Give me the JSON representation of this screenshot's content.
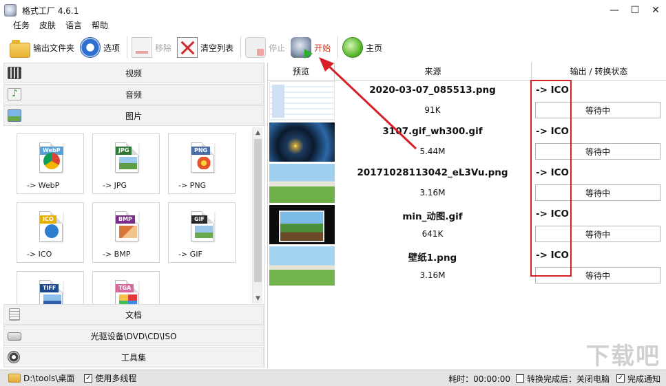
{
  "window": {
    "title": "格式工厂 4.6.1",
    "controls": [
      "—",
      "☐",
      "✕"
    ]
  },
  "menu": [
    "任务",
    "皮肤",
    "语言",
    "帮助"
  ],
  "toolbar": {
    "output_folder": "输出文件夹",
    "options": "选项",
    "remove": "移除",
    "clear_list": "清空列表",
    "stop": "停止",
    "start": "开始",
    "home": "主页"
  },
  "categories": {
    "video": "视频",
    "audio": "音频",
    "image": "图片",
    "document": "文档",
    "disc": "光驱设备\\DVD\\CD\\ISO",
    "tools": "工具集"
  },
  "formats": [
    {
      "tag": "WebP",
      "label": "-> WebP",
      "color": "#5aa0d8"
    },
    {
      "tag": "JPG",
      "label": "-> JPG",
      "color": "#2e7a36"
    },
    {
      "tag": "PNG",
      "label": "-> PNG",
      "color": "#4a6fa8"
    },
    {
      "tag": "ICO",
      "label": "-> ICO",
      "color": "#e6b400"
    },
    {
      "tag": "BMP",
      "label": "-> BMP",
      "color": "#7a2e8a"
    },
    {
      "tag": "GIF",
      "label": "-> GIF",
      "color": "#2a2a2a"
    },
    {
      "tag": "TIFF",
      "label": "",
      "color": "#1d4a8c"
    },
    {
      "tag": "TGA",
      "label": "",
      "color": "#d86aa0"
    }
  ],
  "table": {
    "headers": [
      "预览",
      "来源",
      "输出 / 转换状态"
    ],
    "rows": [
      {
        "name": "2020-03-07_085513.png",
        "size": "91K",
        "output": "-> ICO",
        "status": "等待中"
      },
      {
        "name": "3107.gif_wh300.gif",
        "size": "5.44M",
        "output": "-> ICO",
        "status": "等待中"
      },
      {
        "name": "20171028113042_eL3Vu.png",
        "size": "3.16M",
        "output": "-> ICO",
        "status": "等待中"
      },
      {
        "name": "min_动图.gif",
        "size": "641K",
        "output": "-> ICO",
        "status": "等待中"
      },
      {
        "name": "壁纸1.png",
        "size": "3.16M",
        "output": "-> ICO",
        "status": "等待中"
      }
    ]
  },
  "statusbar": {
    "path": "D:\\tools\\桌面",
    "multithread_label": "使用多线程",
    "multithread_checked": "✓",
    "elapsed": "耗时：00:00:00",
    "after_convert_label": "转换完成后：关闭电脑",
    "after_convert_checked": "",
    "notify_label": "完成通知",
    "notify_checked": "✓"
  },
  "watermark": "下载吧",
  "annotation_color": "#d61f26"
}
